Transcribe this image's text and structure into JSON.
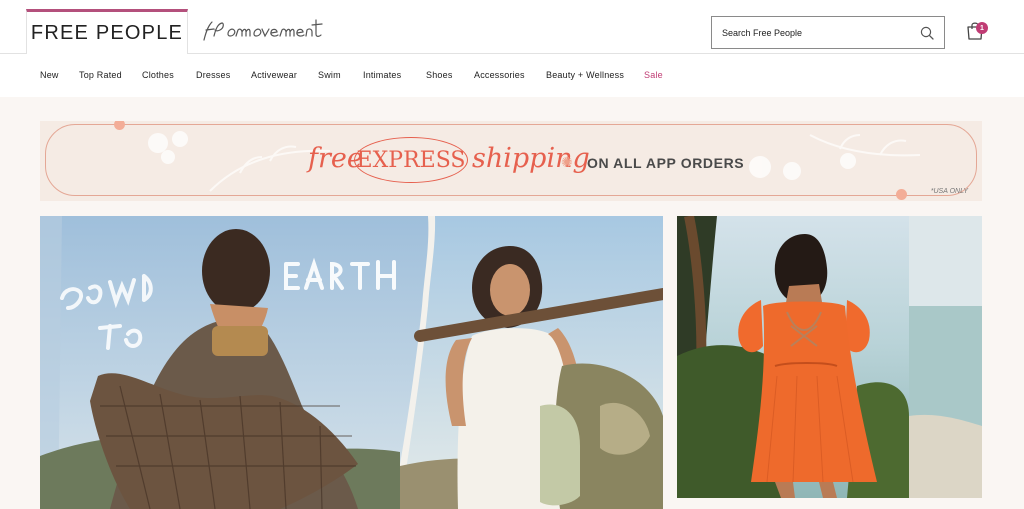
{
  "header": {
    "brand": "FREE PEOPLE",
    "sub_brand_logo": "fp movement",
    "search_placeholder": "Search Free People",
    "cart_count": "1"
  },
  "nav": {
    "items": [
      {
        "label": "New"
      },
      {
        "label": "Top Rated"
      },
      {
        "label": "Clothes"
      },
      {
        "label": "Dresses"
      },
      {
        "label": "Activewear"
      },
      {
        "label": "Swim"
      },
      {
        "label": "Intimates"
      },
      {
        "label": "Shoes"
      },
      {
        "label": "Accessories"
      },
      {
        "label": "Beauty + Wellness"
      },
      {
        "label": "Sale"
      }
    ]
  },
  "promo": {
    "free": "free",
    "express": "EXPRESS",
    "shipping": "shipping",
    "app_orders": "ON ALL APP ORDERS",
    "usa_only": "*USA ONLY"
  },
  "hero": {
    "left_headline": "DOWN TO EARTH"
  },
  "colors": {
    "accent": "#b4507c",
    "sale": "#c03c74",
    "promo_text": "#e6604e"
  },
  "icons": [
    "search-icon",
    "shopping-bag-icon"
  ]
}
